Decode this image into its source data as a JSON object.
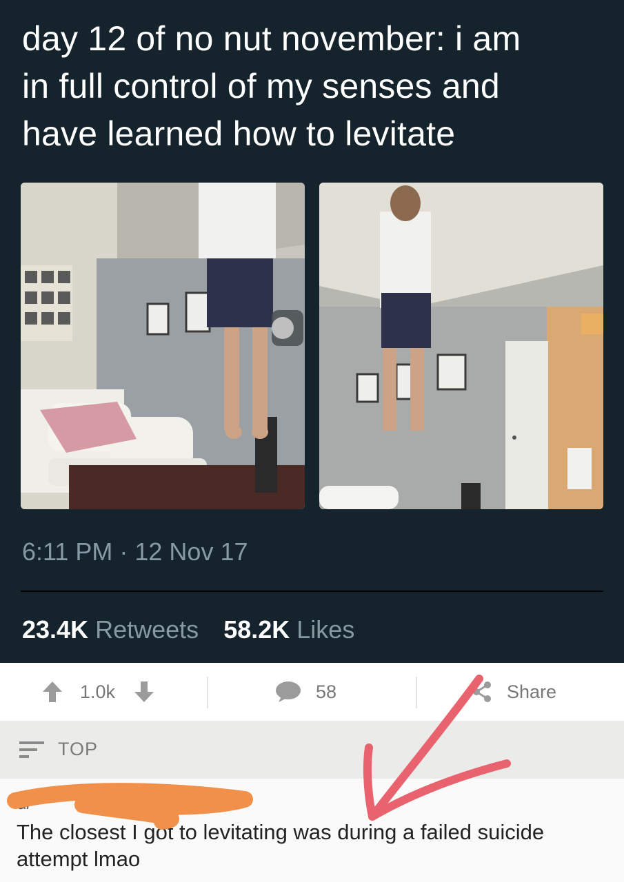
{
  "tweet": {
    "text_lines": [
      "day 12 of no nut november: i am",
      "in full control of my senses and",
      "have learned how to levitate"
    ],
    "timestamp": "6:11 PM · 12 Nov 17",
    "retweets_count": "23.4K",
    "retweets_label": "Retweets",
    "likes_count": "58.2K",
    "likes_label": "Likes"
  },
  "actions": {
    "vote_count": "1.0k",
    "comment_count": "58",
    "share_label": "Share"
  },
  "comments_header": {
    "sort_label": "TOP"
  },
  "comment": {
    "author": "u/",
    "text": "The closest I got to levitating was during a failed suicide attempt lmao"
  },
  "colors": {
    "tweet_background": "#15232d",
    "secondary_text": "#8899a6",
    "arrow": "#e8636d",
    "redaction": "#f0904a"
  }
}
